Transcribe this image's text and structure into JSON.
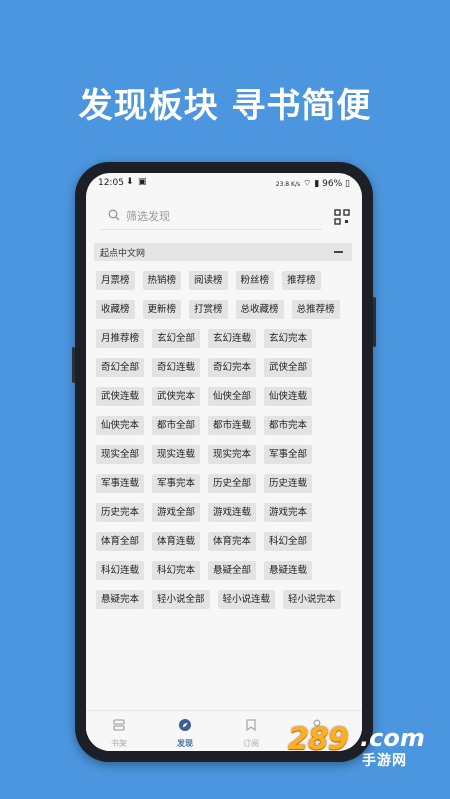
{
  "headline": "发现板块  寻书简便",
  "status_bar": {
    "time": "12:05",
    "speed": "23.8 K/s",
    "battery": "96%"
  },
  "search": {
    "placeholder": "筛选发现"
  },
  "section": {
    "title": "起点中文网"
  },
  "tags": [
    "月票榜",
    "热销榜",
    "阅读榜",
    "粉丝榜",
    "推荐榜",
    "收藏榜",
    "更新榜",
    "打赏榜",
    "总收藏榜",
    "总推荐榜",
    "月推荐榜",
    "玄幻全部",
    "玄幻连载",
    "玄幻完本",
    "奇幻全部",
    "奇幻连载",
    "奇幻完本",
    "武侠全部",
    "武侠连载",
    "武侠完本",
    "仙侠全部",
    "仙侠连载",
    "仙侠完本",
    "都市全部",
    "都市连载",
    "都市完本",
    "现实全部",
    "现实连载",
    "现实完本",
    "军事全部",
    "军事连载",
    "军事完本",
    "历史全部",
    "历史连载",
    "历史完本",
    "游戏全部",
    "游戏连载",
    "游戏完本",
    "体育全部",
    "体育连载",
    "体育完本",
    "科幻全部",
    "科幻连载",
    "科幻完本",
    "悬疑全部",
    "悬疑连载",
    "悬疑完本",
    "轻小说全部",
    "轻小说连载",
    "轻小说完本"
  ],
  "bottom_nav": [
    {
      "label": "书架",
      "icon": "bookshelf-icon",
      "active": false
    },
    {
      "label": "发现",
      "icon": "compass-icon",
      "active": true
    },
    {
      "label": "订阅",
      "icon": "bookmark-icon",
      "active": false
    },
    {
      "label": "我的",
      "icon": "user-icon",
      "active": false
    }
  ],
  "watermark": {
    "brand": "289",
    "domain": ".com",
    "sub": "手游网"
  },
  "colors": {
    "background": "#4b96de",
    "accent": "#4a6fa8",
    "tag_bg": "#e3e3e3"
  }
}
